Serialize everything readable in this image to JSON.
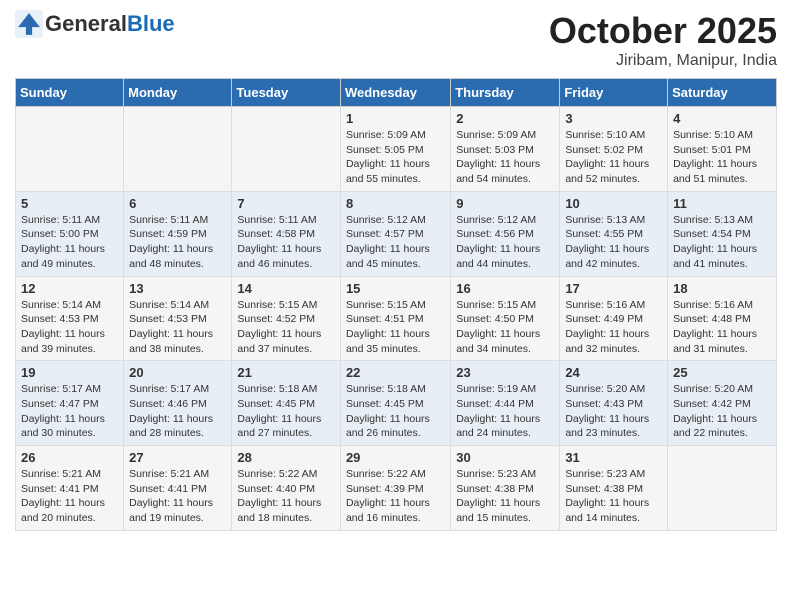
{
  "header": {
    "logo_general": "General",
    "logo_blue": "Blue",
    "title": "October 2025",
    "subtitle": "Jiribam, Manipur, India"
  },
  "weekdays": [
    "Sunday",
    "Monday",
    "Tuesday",
    "Wednesday",
    "Thursday",
    "Friday",
    "Saturday"
  ],
  "weeks": [
    [
      {
        "day": "",
        "content": ""
      },
      {
        "day": "",
        "content": ""
      },
      {
        "day": "",
        "content": ""
      },
      {
        "day": "1",
        "content": "Sunrise: 5:09 AM\nSunset: 5:05 PM\nDaylight: 11 hours and 55 minutes."
      },
      {
        "day": "2",
        "content": "Sunrise: 5:09 AM\nSunset: 5:03 PM\nDaylight: 11 hours and 54 minutes."
      },
      {
        "day": "3",
        "content": "Sunrise: 5:10 AM\nSunset: 5:02 PM\nDaylight: 11 hours and 52 minutes."
      },
      {
        "day": "4",
        "content": "Sunrise: 5:10 AM\nSunset: 5:01 PM\nDaylight: 11 hours and 51 minutes."
      }
    ],
    [
      {
        "day": "5",
        "content": "Sunrise: 5:11 AM\nSunset: 5:00 PM\nDaylight: 11 hours and 49 minutes."
      },
      {
        "day": "6",
        "content": "Sunrise: 5:11 AM\nSunset: 4:59 PM\nDaylight: 11 hours and 48 minutes."
      },
      {
        "day": "7",
        "content": "Sunrise: 5:11 AM\nSunset: 4:58 PM\nDaylight: 11 hours and 46 minutes."
      },
      {
        "day": "8",
        "content": "Sunrise: 5:12 AM\nSunset: 4:57 PM\nDaylight: 11 hours and 45 minutes."
      },
      {
        "day": "9",
        "content": "Sunrise: 5:12 AM\nSunset: 4:56 PM\nDaylight: 11 hours and 44 minutes."
      },
      {
        "day": "10",
        "content": "Sunrise: 5:13 AM\nSunset: 4:55 PM\nDaylight: 11 hours and 42 minutes."
      },
      {
        "day": "11",
        "content": "Sunrise: 5:13 AM\nSunset: 4:54 PM\nDaylight: 11 hours and 41 minutes."
      }
    ],
    [
      {
        "day": "12",
        "content": "Sunrise: 5:14 AM\nSunset: 4:53 PM\nDaylight: 11 hours and 39 minutes."
      },
      {
        "day": "13",
        "content": "Sunrise: 5:14 AM\nSunset: 4:53 PM\nDaylight: 11 hours and 38 minutes."
      },
      {
        "day": "14",
        "content": "Sunrise: 5:15 AM\nSunset: 4:52 PM\nDaylight: 11 hours and 37 minutes."
      },
      {
        "day": "15",
        "content": "Sunrise: 5:15 AM\nSunset: 4:51 PM\nDaylight: 11 hours and 35 minutes."
      },
      {
        "day": "16",
        "content": "Sunrise: 5:15 AM\nSunset: 4:50 PM\nDaylight: 11 hours and 34 minutes."
      },
      {
        "day": "17",
        "content": "Sunrise: 5:16 AM\nSunset: 4:49 PM\nDaylight: 11 hours and 32 minutes."
      },
      {
        "day": "18",
        "content": "Sunrise: 5:16 AM\nSunset: 4:48 PM\nDaylight: 11 hours and 31 minutes."
      }
    ],
    [
      {
        "day": "19",
        "content": "Sunrise: 5:17 AM\nSunset: 4:47 PM\nDaylight: 11 hours and 30 minutes."
      },
      {
        "day": "20",
        "content": "Sunrise: 5:17 AM\nSunset: 4:46 PM\nDaylight: 11 hours and 28 minutes."
      },
      {
        "day": "21",
        "content": "Sunrise: 5:18 AM\nSunset: 4:45 PM\nDaylight: 11 hours and 27 minutes."
      },
      {
        "day": "22",
        "content": "Sunrise: 5:18 AM\nSunset: 4:45 PM\nDaylight: 11 hours and 26 minutes."
      },
      {
        "day": "23",
        "content": "Sunrise: 5:19 AM\nSunset: 4:44 PM\nDaylight: 11 hours and 24 minutes."
      },
      {
        "day": "24",
        "content": "Sunrise: 5:20 AM\nSunset: 4:43 PM\nDaylight: 11 hours and 23 minutes."
      },
      {
        "day": "25",
        "content": "Sunrise: 5:20 AM\nSunset: 4:42 PM\nDaylight: 11 hours and 22 minutes."
      }
    ],
    [
      {
        "day": "26",
        "content": "Sunrise: 5:21 AM\nSunset: 4:41 PM\nDaylight: 11 hours and 20 minutes."
      },
      {
        "day": "27",
        "content": "Sunrise: 5:21 AM\nSunset: 4:41 PM\nDaylight: 11 hours and 19 minutes."
      },
      {
        "day": "28",
        "content": "Sunrise: 5:22 AM\nSunset: 4:40 PM\nDaylight: 11 hours and 18 minutes."
      },
      {
        "day": "29",
        "content": "Sunrise: 5:22 AM\nSunset: 4:39 PM\nDaylight: 11 hours and 16 minutes."
      },
      {
        "day": "30",
        "content": "Sunrise: 5:23 AM\nSunset: 4:38 PM\nDaylight: 11 hours and 15 minutes."
      },
      {
        "day": "31",
        "content": "Sunrise: 5:23 AM\nSunset: 4:38 PM\nDaylight: 11 hours and 14 minutes."
      },
      {
        "day": "",
        "content": ""
      }
    ]
  ]
}
